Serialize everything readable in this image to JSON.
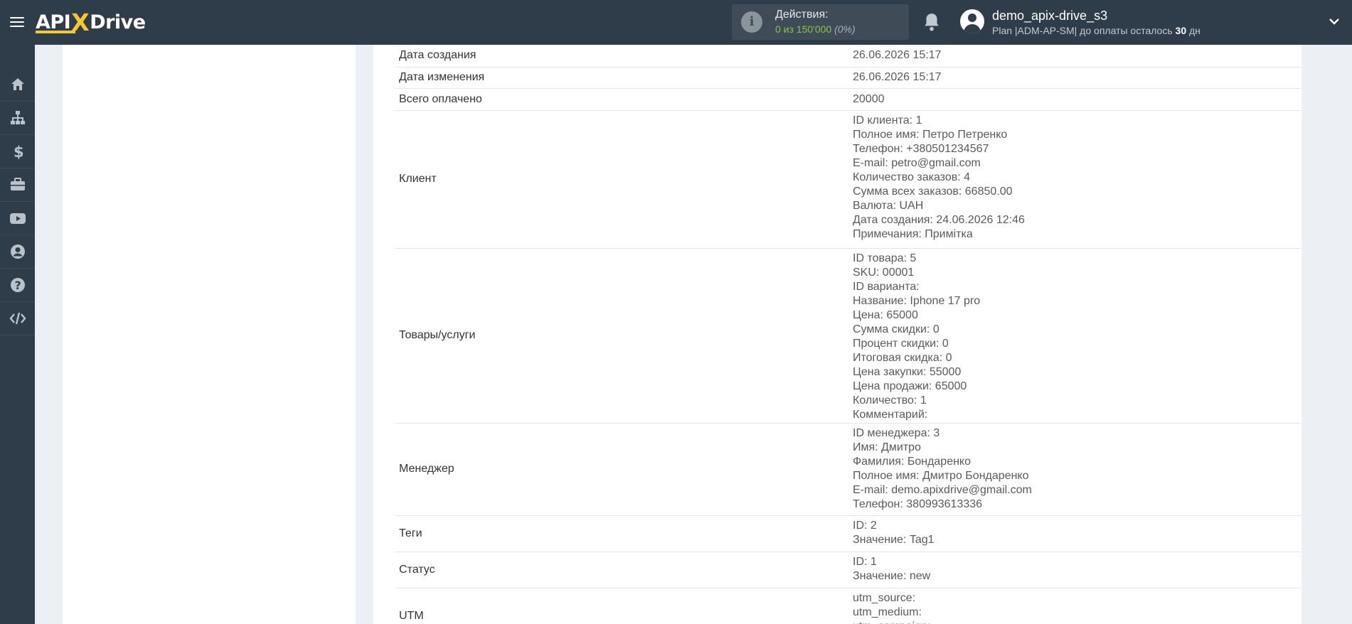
{
  "brand": {
    "left": "API",
    "x": "X",
    "right": "Drive"
  },
  "actions": {
    "label": "Действия:",
    "count": "0 из 150'000",
    "percent": "(0%)"
  },
  "user": {
    "name": "demo_apix-drive_s3",
    "plan_prefix": "Plan |ADM-AP-SM| до оплаты осталось ",
    "days": "30",
    "days_suffix": " дн"
  },
  "nav_icons": [
    "home-icon",
    "sitemap-icon",
    "dollar-icon",
    "briefcase-icon",
    "youtube-icon",
    "user-circle-icon",
    "question-icon",
    "code-icon"
  ],
  "rows": [
    {
      "key": "Дата создания",
      "values": [
        "26.06.2026 15:17"
      ]
    },
    {
      "key": "Дата изменения",
      "values": [
        "26.06.2026 15:17"
      ]
    },
    {
      "key": "Всего оплачено",
      "values": [
        "20000"
      ]
    },
    {
      "key": "Клиент",
      "values": [
        "ID клиента: 1",
        "Полное имя: Петро Петренко",
        "Телефон: +380501234567",
        "E-mail: petro@gmail.com",
        "Количество заказов: 4",
        "Сумма всех заказов: 66850.00",
        "Валюта: UAH",
        "Дата создания: 24.06.2026 12:46",
        "Примечания: Примітка"
      ]
    },
    {
      "key": "Товары/услуги",
      "values": [
        "ID товара: 5",
        "SKU: 00001",
        "ID варианта:",
        "Название: Iphone 17 pro",
        "Цена: 65000",
        "Сумма скидки: 0",
        "Процент скидки: 0",
        "Итоговая скидка: 0",
        "Цена закупки: 55000",
        "Цена продажи: 65000",
        "Количество: 1",
        "Комментарий:"
      ]
    },
    {
      "key": "Менеджер",
      "values": [
        "ID менеджера: 3",
        "Имя: Дмитро",
        "Фамилия: Бондаренко",
        "Полное имя: Дмитро Бондаренко",
        "E-mail: demo.apixdrive@gmail.com",
        "Телефон: 380993613336"
      ]
    },
    {
      "key": "Теги",
      "values": [
        "ID: 2",
        "Значение: Tag1"
      ]
    },
    {
      "key": "Статус",
      "values": [
        "ID: 1",
        "Значение: new"
      ]
    },
    {
      "key": "UTM",
      "values": [
        "utm_source:",
        "utm_medium:",
        "utm_campaign:"
      ]
    }
  ]
}
